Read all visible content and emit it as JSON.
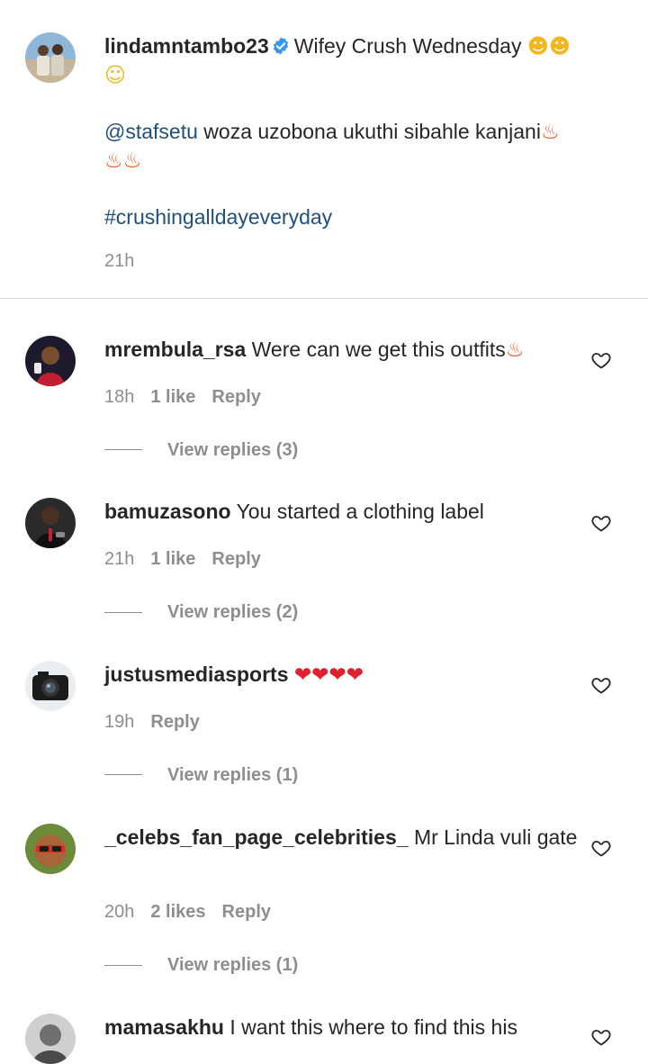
{
  "caption": {
    "username": "lindamntambo23",
    "text": "Wifey Crush Wednesday",
    "mention": "@stafsetu",
    "mention_text": "woza uzobona ukuthi sibahle kanjani",
    "hashtag": "#crushingalldayeveryday",
    "time": "21h"
  },
  "comments": [
    {
      "username": "mrembula_rsa",
      "text": "Were can we get this outfits",
      "time": "18h",
      "likes": "1 like",
      "reply": "Reply",
      "view_replies": "View replies (3)"
    },
    {
      "username": "bamuzasono",
      "text": "You started a clothing label",
      "time": "21h",
      "likes": "1 like",
      "reply": "Reply",
      "view_replies": "View replies (2)"
    },
    {
      "username": "justusmediasports",
      "text": "",
      "time": "19h",
      "likes": "",
      "reply": "Reply",
      "view_replies": "View replies (1)"
    },
    {
      "username": "_celebs_fan_page_celebrities_",
      "text": "Mr Linda vuli gate",
      "time": "20h",
      "likes": "2 likes",
      "reply": "Reply",
      "view_replies": "View replies (1)"
    },
    {
      "username": "mamasakhu",
      "text": "I want this where to find this his",
      "time": "",
      "likes": "",
      "reply": "",
      "view_replies": ""
    }
  ],
  "icons": {
    "verified": "verified-badge-icon",
    "like": "heart-outline-icon"
  },
  "colors": {
    "link": "#1f4f7a",
    "meta": "#8e8e8e",
    "verified": "#3897f0",
    "text": "#262626"
  }
}
